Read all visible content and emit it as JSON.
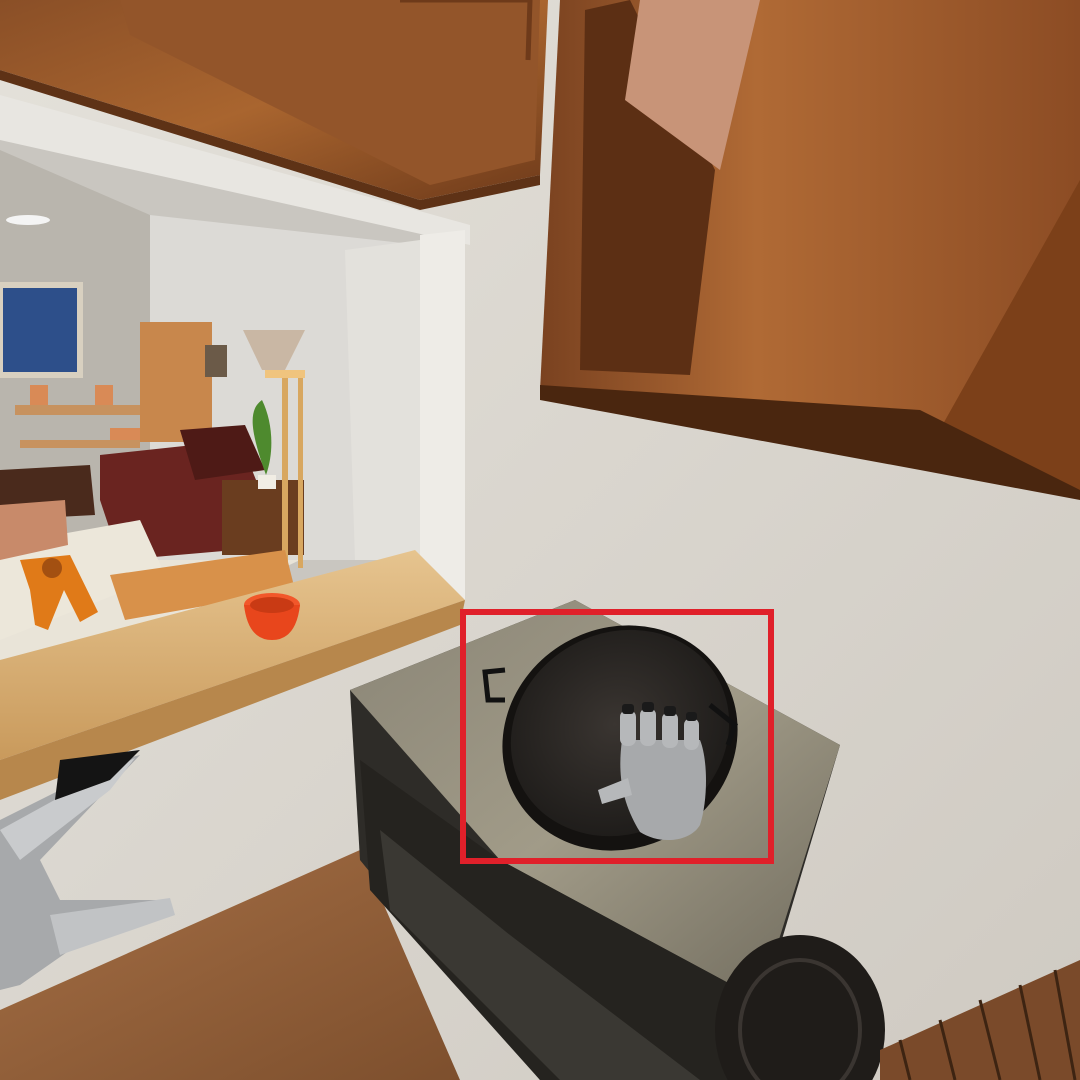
{
  "scene": {
    "kind": "vr-kitchen-first-person",
    "highlight_color": "#e0202a",
    "highlight_target": "frying-pan",
    "objects": [
      "upper-cabinet-left",
      "upper-cabinet-right",
      "doorway-to-living-room",
      "sofa",
      "bookshelf",
      "floor-lamp",
      "potted-plant",
      "toy-robot",
      "counter-ledge",
      "orange-bowl",
      "stove",
      "frying-pan",
      "right-vr-hand",
      "left-vr-hand"
    ]
  }
}
